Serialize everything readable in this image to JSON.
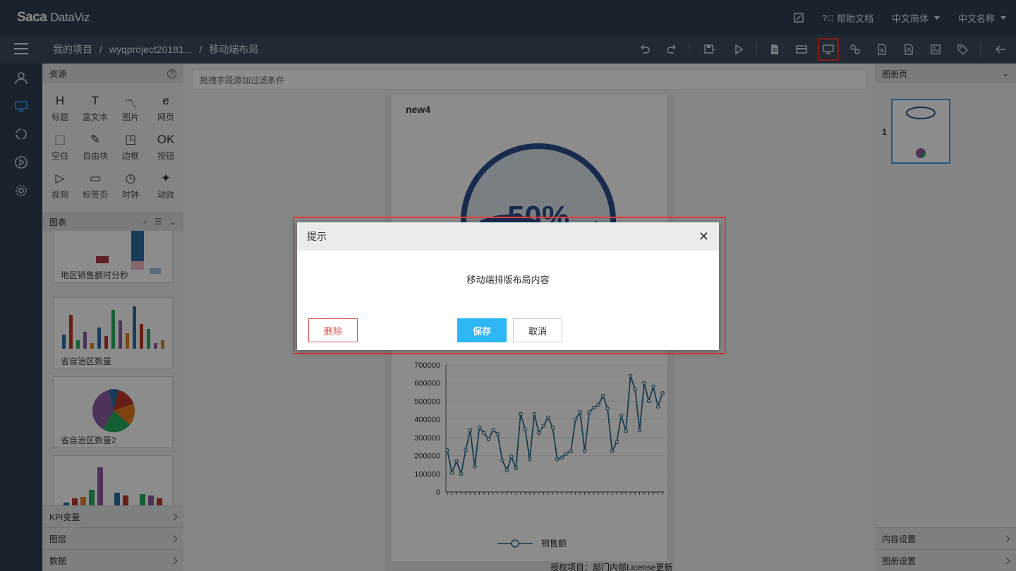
{
  "topbar": {
    "logo_text": "Saca",
    "logo_rest": "DataViz",
    "help": "帮助文档",
    "language": "中文简体",
    "user": "中文名称"
  },
  "breadcrumb": {
    "root": "我的项目",
    "project": "wyqproject20181...",
    "current": "移动端布局"
  },
  "toolbar_icons": [
    "undo-icon",
    "redo-icon",
    "save-icon",
    "play-icon",
    "document-icon",
    "card-icon",
    "monitor-icon",
    "link-icon",
    "excel-icon",
    "pdf-icon",
    "image-icon",
    "tag-icon",
    "back-icon"
  ],
  "resources": {
    "title": "资源",
    "items": [
      {
        "icon": "H",
        "label": "标题"
      },
      {
        "icon": "T",
        "label": "富文本"
      },
      {
        "icon": "〽",
        "label": "图片"
      },
      {
        "icon": "e",
        "label": "网页"
      },
      {
        "icon": "⬚",
        "label": "空白"
      },
      {
        "icon": "✎",
        "label": "自由块"
      },
      {
        "icon": "◳",
        "label": "边框"
      },
      {
        "icon": "OK",
        "label": "按钮"
      },
      {
        "icon": "▷",
        "label": "视频"
      },
      {
        "icon": "▭",
        "label": "标签页"
      },
      {
        "icon": "◷",
        "label": "时钟"
      },
      {
        "icon": "✦",
        "label": "动效"
      }
    ]
  },
  "charts_panel": {
    "title": "图表",
    "thumbs": [
      "地区销售额时分秒",
      "省自治区数量",
      "省自治区数量2"
    ]
  },
  "accordions": [
    "KPI变量",
    "图层",
    "数据"
  ],
  "canvas": {
    "filter_placeholder": "拖拽字段添加过滤条件",
    "card_title": "new4",
    "gauge_text": "50%",
    "license": "授权项目：部门内部License更新"
  },
  "chart_data": {
    "type": "line",
    "yticks": [
      "700000",
      "600000",
      "500000",
      "400000",
      "300000",
      "200000",
      "100000",
      "0"
    ],
    "ylim": [
      0,
      700000
    ],
    "legend": "销售额",
    "values": [
      230000,
      105000,
      170000,
      100000,
      230000,
      340000,
      140000,
      355000,
      325000,
      290000,
      340000,
      320000,
      175000,
      120000,
      195000,
      130000,
      430000,
      345000,
      180000,
      430000,
      325000,
      365000,
      410000,
      355000,
      180000,
      190000,
      210000,
      225000,
      400000,
      440000,
      225000,
      440000,
      465000,
      480000,
      530000,
      460000,
      225000,
      275000,
      420000,
      335000,
      640000,
      565000,
      340000,
      600000,
      500000,
      580000,
      470000,
      545000
    ]
  },
  "rightpanel": {
    "title": "图册页",
    "page_no": "1",
    "content_settings": "内容设置",
    "album_settings": "图册设置"
  },
  "dialog": {
    "title": "提示",
    "message": "移动端排版布局内容",
    "delete": "删除",
    "save": "保存",
    "cancel": "取消"
  }
}
